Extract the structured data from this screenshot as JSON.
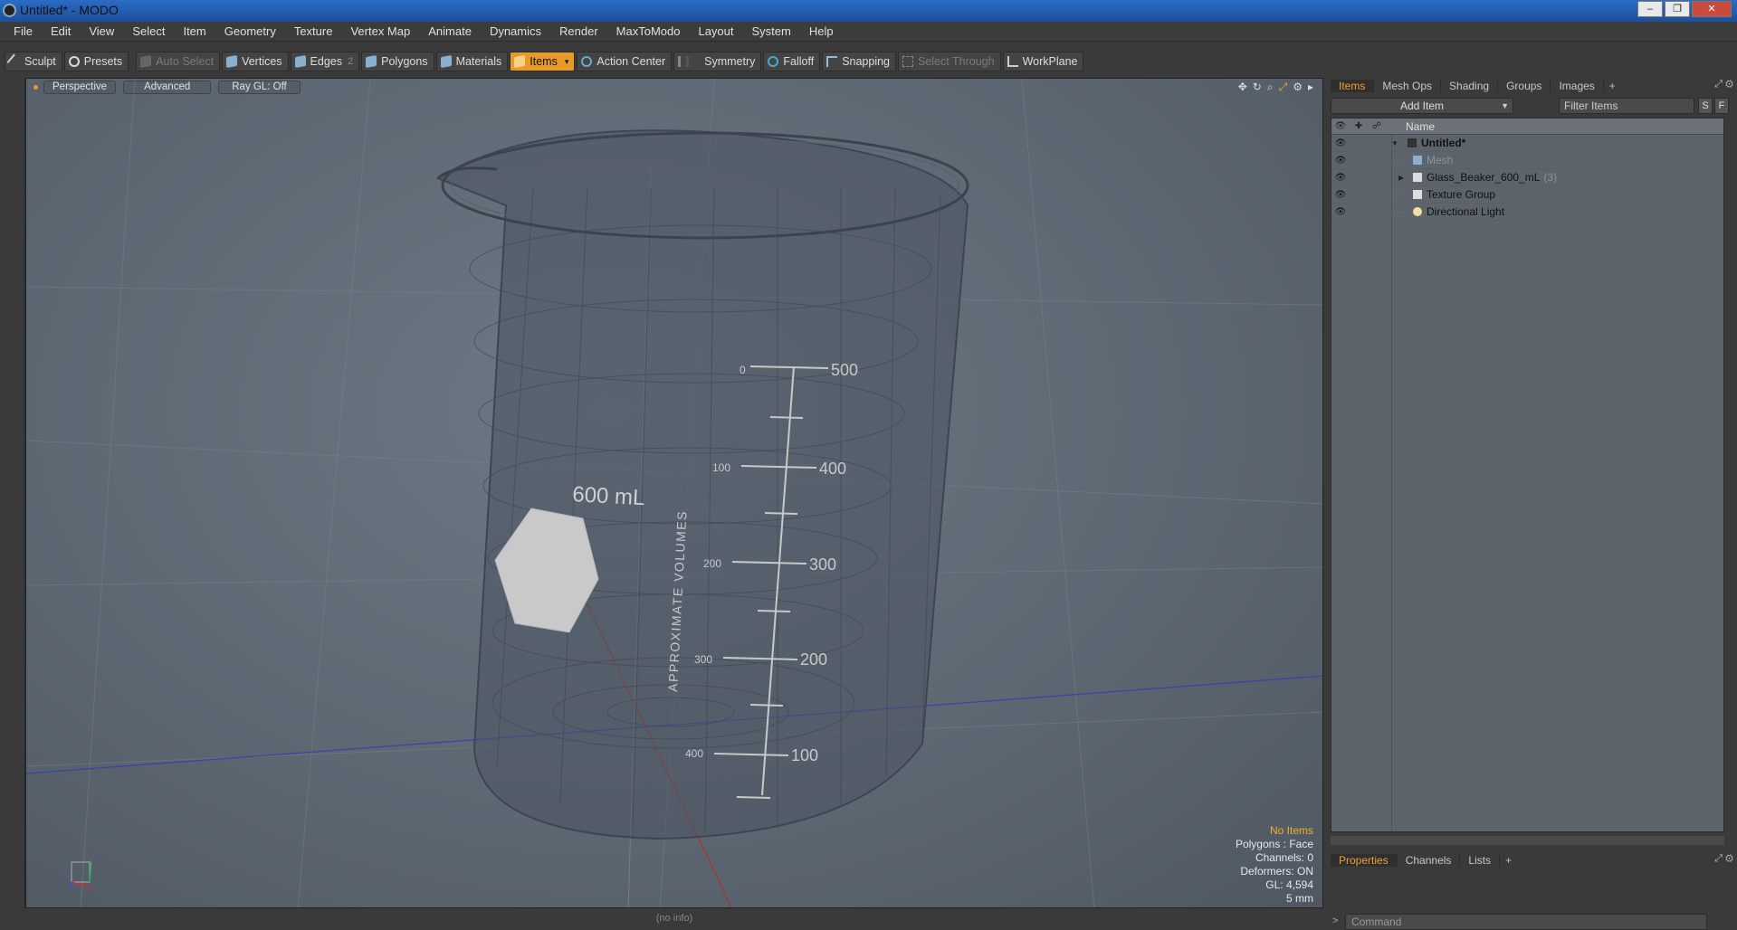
{
  "window": {
    "title": "Untitled* - MODO",
    "controls": [
      "–",
      "❐",
      "✕"
    ]
  },
  "menu": [
    "File",
    "Edit",
    "View",
    "Select",
    "Item",
    "Geometry",
    "Texture",
    "Vertex Map",
    "Animate",
    "Dynamics",
    "Render",
    "MaxToModo",
    "Layout",
    "System",
    "Help"
  ],
  "toolbar": {
    "sculpt": "Sculpt",
    "presets": "Presets",
    "auto_select": "Auto Select",
    "vertices": "Vertices",
    "edges": "Edges",
    "edges_count": "2",
    "polygons": "Polygons",
    "materials": "Materials",
    "items": "Items",
    "action_center": "Action Center",
    "symmetry": "Symmetry",
    "falloff": "Falloff",
    "snapping": "Snapping",
    "select_through": "Select Through",
    "workplane": "WorkPlane"
  },
  "viewport": {
    "view": "Perspective",
    "advanced": "Advanced",
    "raygl": "Ray GL: Off",
    "beaker_label": "600 mL",
    "side_text": "APPROXIMATE  VOLUMES",
    "scale_right": [
      "500",
      "400",
      "300",
      "200",
      "100"
    ],
    "scale_left": [
      "0",
      "100",
      "200",
      "300",
      "400"
    ],
    "stats": {
      "items": "No Items",
      "polygons": "Polygons : Face",
      "channels": "Channels: 0",
      "deformers": "Deformers: ON",
      "gl": "GL: 4,594",
      "unit": "5 mm"
    }
  },
  "panel": {
    "tabs": [
      "Items",
      "Mesh Ops",
      "Shading",
      "Groups",
      "Images"
    ],
    "add_item": "Add Item",
    "filter": "Filter Items",
    "s_btn": "S",
    "f_btn": "F",
    "name_col": "Name",
    "rows": [
      {
        "name": "Untitled*",
        "count": ""
      },
      {
        "name": "Mesh",
        "count": ""
      },
      {
        "name": "Glass_Beaker_600_mL",
        "count": "(3)"
      },
      {
        "name": "Texture Group",
        "count": ""
      },
      {
        "name": "Directional Light",
        "count": ""
      }
    ],
    "bottom_tabs": [
      "Properties",
      "Channels",
      "Lists"
    ],
    "command_placeholder": "Command"
  },
  "status": "(no info)",
  "colors": {
    "accent": "#e89a28",
    "viewport": "#5e6873",
    "panel": "#3a3a3a"
  }
}
